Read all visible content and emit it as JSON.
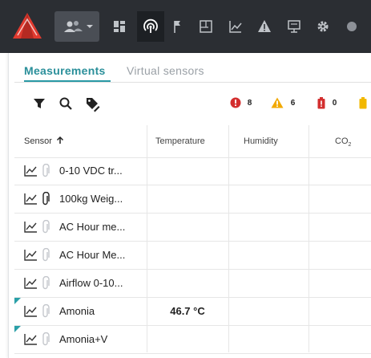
{
  "app": {
    "accent": "#2a9aa6",
    "topbar_color": "#2b2e33",
    "logo_color": "#e03a2f"
  },
  "nav": {
    "icons": [
      "logo-icon",
      "users-icon",
      "dashboard-icon",
      "sensors-icon",
      "flag-icon",
      "floorplan-icon",
      "charts-icon",
      "alerts-icon",
      "gateway-icon",
      "settings-icon"
    ]
  },
  "tabs": [
    {
      "label": "Measurements",
      "active": true
    },
    {
      "label": "Virtual sensors",
      "active": false
    }
  ],
  "toolbar": {
    "badges": [
      {
        "icon": "error-circle-icon",
        "count": "8",
        "color": "#d32f2f"
      },
      {
        "icon": "warning-triangle-icon",
        "count": "6",
        "color": "#f2a900"
      },
      {
        "icon": "battery-low-icon",
        "count": "0",
        "color": "#d32f2f"
      },
      {
        "icon": "battery-warning-icon",
        "count": "",
        "color": "#f2b800"
      }
    ]
  },
  "table": {
    "columns": [
      "Sensor",
      "Temperature",
      "Humidity",
      "CO",
      "2"
    ],
    "rows": [
      {
        "name": "0-10 VDC tr...",
        "attached": false,
        "temp": "",
        "flag": false
      },
      {
        "name": "100kg Weig...",
        "attached": true,
        "temp": "",
        "flag": false
      },
      {
        "name": "AC Hour me...",
        "attached": false,
        "temp": "",
        "flag": false
      },
      {
        "name": "AC Hour Me...",
        "attached": false,
        "temp": "",
        "flag": false
      },
      {
        "name": "Airflow 0-10...",
        "attached": false,
        "temp": "",
        "flag": false
      },
      {
        "name": "Amonia",
        "attached": false,
        "temp": "46.7 °C",
        "flag": true
      },
      {
        "name": "Amonia+V",
        "attached": false,
        "temp": "",
        "flag": true
      }
    ]
  }
}
